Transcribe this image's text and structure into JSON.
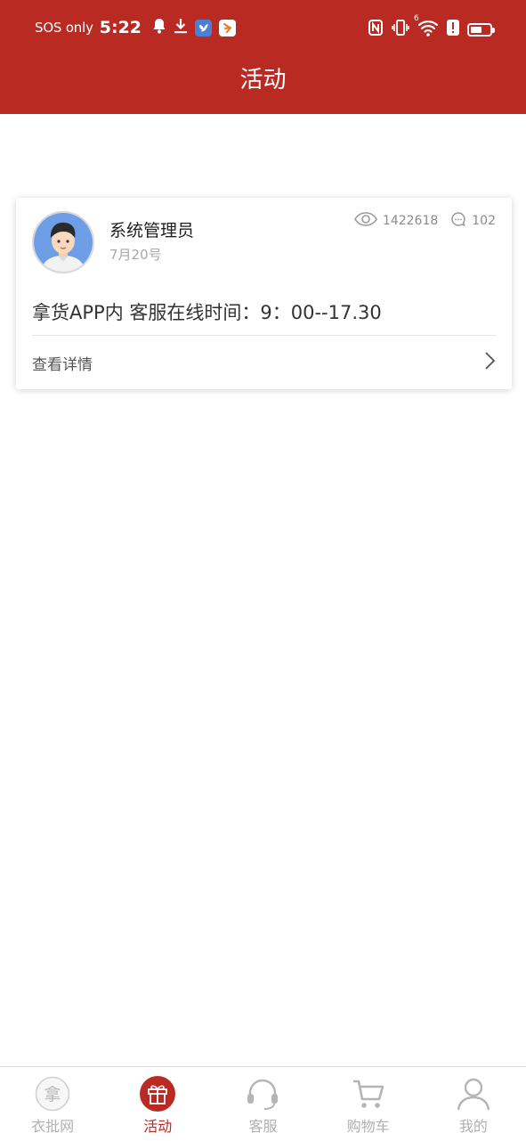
{
  "status_bar": {
    "carrier_text": "SOS only",
    "time": "5:22",
    "left_icons": [
      "bell-icon",
      "download-icon",
      "app-bird-icon",
      "app-runner-icon"
    ],
    "right_icons": [
      "nfc-icon",
      "vibrate-icon",
      "wifi-icon",
      "alert-icon",
      "battery-icon"
    ],
    "wifi_tag": "6",
    "battery_level": 0.5
  },
  "header": {
    "title": "活动",
    "background": "#b92a22"
  },
  "post": {
    "author": "系统管理员",
    "date": "7月20号",
    "views": "1422618",
    "comments": "102",
    "content": "拿货APP内 客服在线时间：9：00--17.30",
    "details_label": "查看详情"
  },
  "bottom_nav": {
    "active_color": "#b92a22",
    "items": [
      {
        "label": "衣批网",
        "icon": "logo-icon",
        "logo_char": "拿",
        "active": false
      },
      {
        "label": "活动",
        "icon": "gift-icon",
        "active": true
      },
      {
        "label": "客服",
        "icon": "headset-icon",
        "active": false
      },
      {
        "label": "购物车",
        "icon": "cart-icon",
        "active": false
      },
      {
        "label": "我的",
        "icon": "user-icon",
        "active": false
      }
    ]
  }
}
